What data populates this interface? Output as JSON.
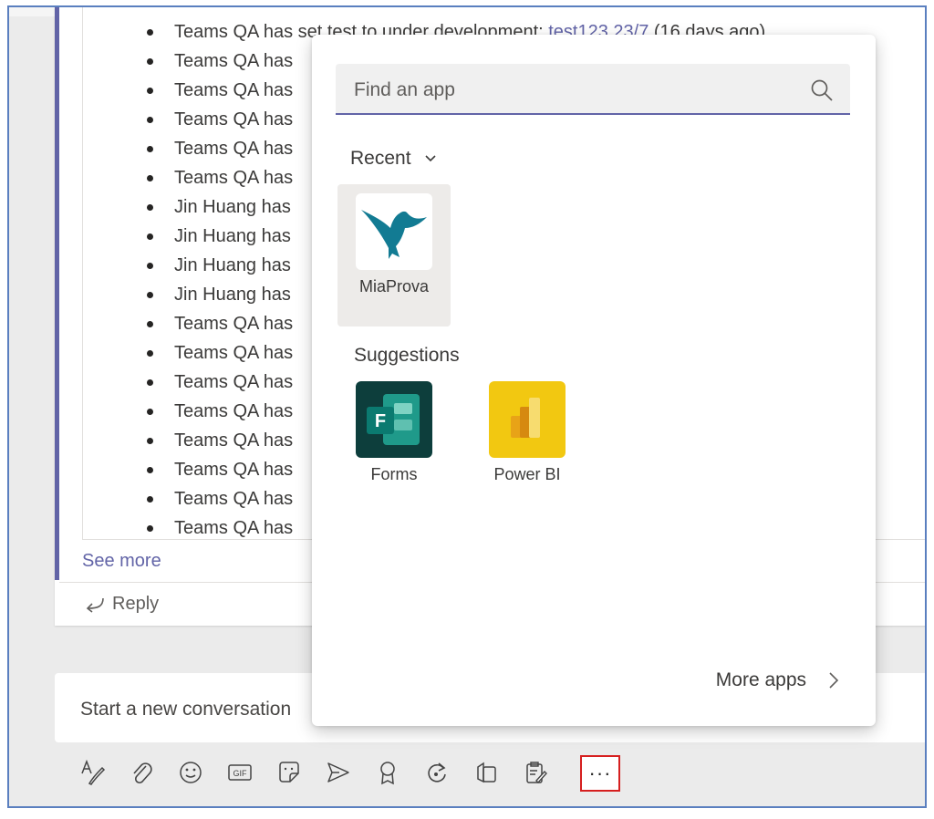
{
  "thread": {
    "activities": [
      {
        "actor": "Teams QA",
        "text": "has set test to under development: ",
        "link": "test123 23/7",
        "suffix": " (16 days ago)"
      },
      {
        "actor": "Teams QA",
        "text": "has"
      },
      {
        "actor": "Teams QA",
        "text": "has"
      },
      {
        "actor": "Teams QA",
        "text": "has"
      },
      {
        "actor": "Teams QA",
        "text": "has"
      },
      {
        "actor": "Teams QA",
        "text": "has"
      },
      {
        "actor": "Jin Huang",
        "text": "has"
      },
      {
        "actor": "Jin Huang",
        "text": "has"
      },
      {
        "actor": "Jin Huang",
        "text": "has"
      },
      {
        "actor": "Jin Huang",
        "text": "has"
      },
      {
        "actor": "Teams QA",
        "text": "has"
      },
      {
        "actor": "Teams QA",
        "text": "has"
      },
      {
        "actor": "Teams QA",
        "text": "has"
      },
      {
        "actor": "Teams QA",
        "text": "has"
      },
      {
        "actor": "Teams QA",
        "text": "has"
      },
      {
        "actor": "Teams QA",
        "text": "has"
      },
      {
        "actor": "Teams QA",
        "text": "has"
      },
      {
        "actor": "Teams QA",
        "text": "has"
      }
    ],
    "see_more_label": "See more",
    "reply_label": "Reply"
  },
  "compose": {
    "placeholder": "Start a new conversation"
  },
  "toolbar": {
    "tools": [
      {
        "icon": "format-icon"
      },
      {
        "icon": "attach-icon"
      },
      {
        "icon": "emoji-icon"
      },
      {
        "icon": "gif-icon",
        "label": "GIF"
      },
      {
        "icon": "sticker-icon"
      },
      {
        "icon": "meet-now-icon"
      },
      {
        "icon": "praise-icon"
      },
      {
        "icon": "loop-icon"
      },
      {
        "icon": "stream-icon"
      },
      {
        "icon": "notes-icon"
      }
    ],
    "more_label": "···"
  },
  "app_popup": {
    "search_placeholder": "Find an app",
    "recent_label": "Recent",
    "recent_apps": [
      {
        "name": "MiaProva",
        "icon": "miaprova-bird-icon"
      }
    ],
    "suggestions_label": "Suggestions",
    "suggested_apps": [
      {
        "name": "Forms",
        "icon": "forms-icon",
        "bg": "#035f5a"
      },
      {
        "name": "Power BI",
        "icon": "power-bi-icon",
        "bg": "#f2c811"
      }
    ],
    "more_apps_label": "More apps"
  },
  "colors": {
    "accent": "#6264a7",
    "highlight_box": "#d61f1f",
    "frame_border": "#5a7fbf"
  }
}
